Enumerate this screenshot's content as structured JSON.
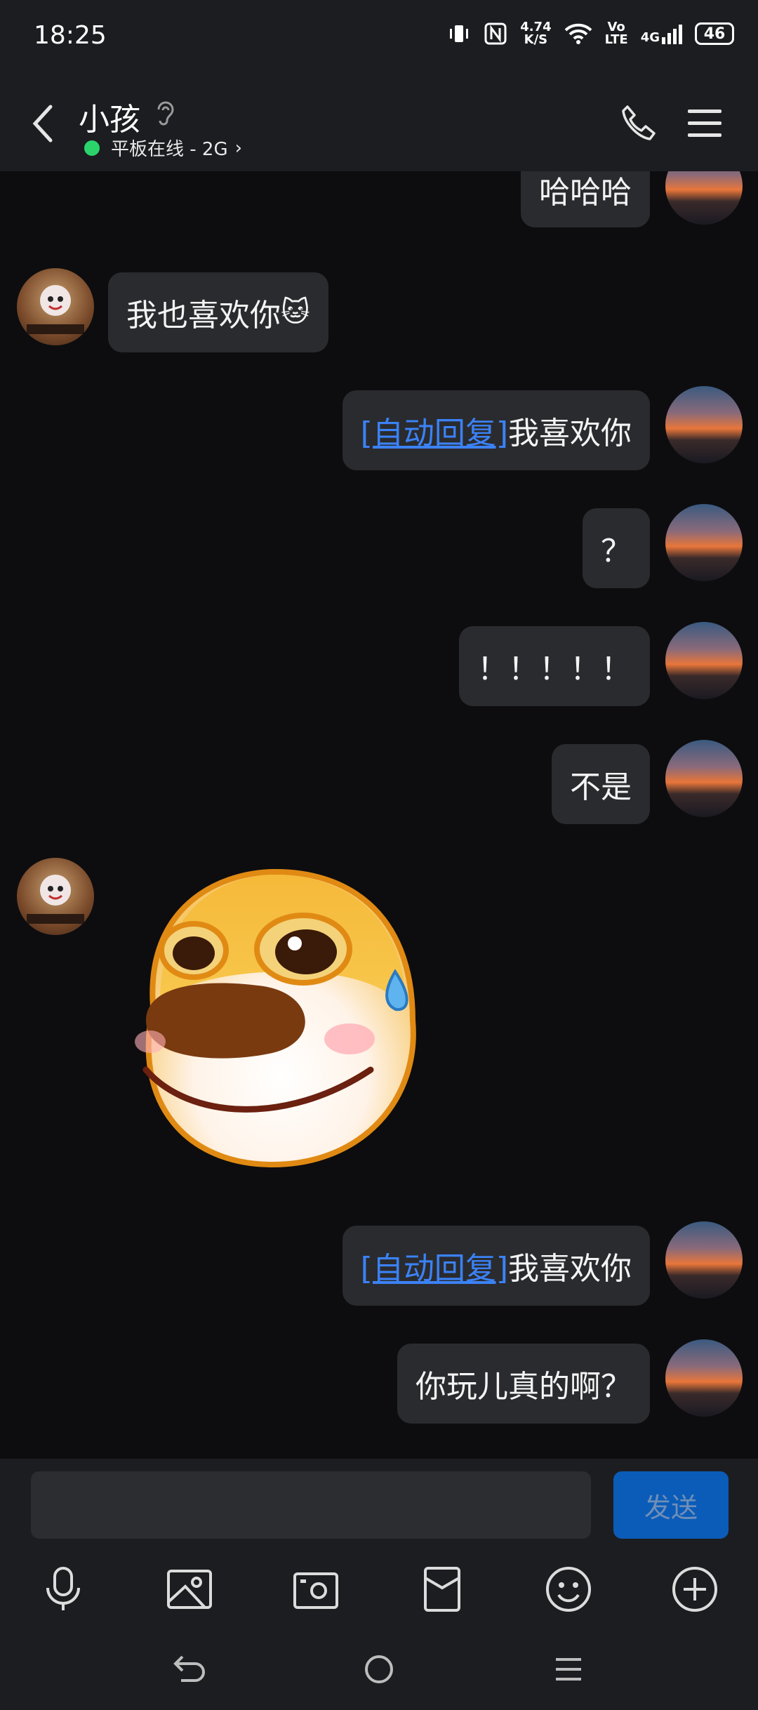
{
  "status": {
    "time": "18:25",
    "net_speed_top": "4.74",
    "net_speed_bottom": "K/S",
    "vo": "Vo",
    "lte": "LTE",
    "net_type": "4G",
    "battery": "46"
  },
  "header": {
    "title": "小孩",
    "subtitle": "平板在线 - 2G",
    "online_color": "#2bd46b"
  },
  "messages": [
    {
      "side": "right",
      "text": "哈哈哈"
    },
    {
      "side": "left",
      "text": "我也喜欢你",
      "emoji": "🐱"
    },
    {
      "side": "right",
      "prefix": "[自动回复]",
      "text": "我喜欢你"
    },
    {
      "side": "right",
      "text": "？"
    },
    {
      "side": "right",
      "text": "！！！！！"
    },
    {
      "side": "right",
      "text": "不是"
    },
    {
      "side": "left",
      "sticker": "sweating-smiling-dog-sticker"
    },
    {
      "side": "right",
      "prefix": "[自动回复]",
      "text": "我喜欢你"
    },
    {
      "side": "right",
      "text": "你玩儿真的啊？"
    }
  ],
  "input": {
    "placeholder": "",
    "send_label": "发送"
  },
  "toolbar": [
    "mic-icon",
    "image-icon",
    "camera-icon",
    "red-packet-icon",
    "emoji-icon",
    "add-icon"
  ],
  "nav": [
    "back-nav-icon",
    "home-nav-icon",
    "recents-nav-icon"
  ],
  "colors": {
    "link": "#3b82f6",
    "bubble": "#2a2b2f",
    "background": "#0d0d0f",
    "send_button": "#0b5cb8"
  }
}
